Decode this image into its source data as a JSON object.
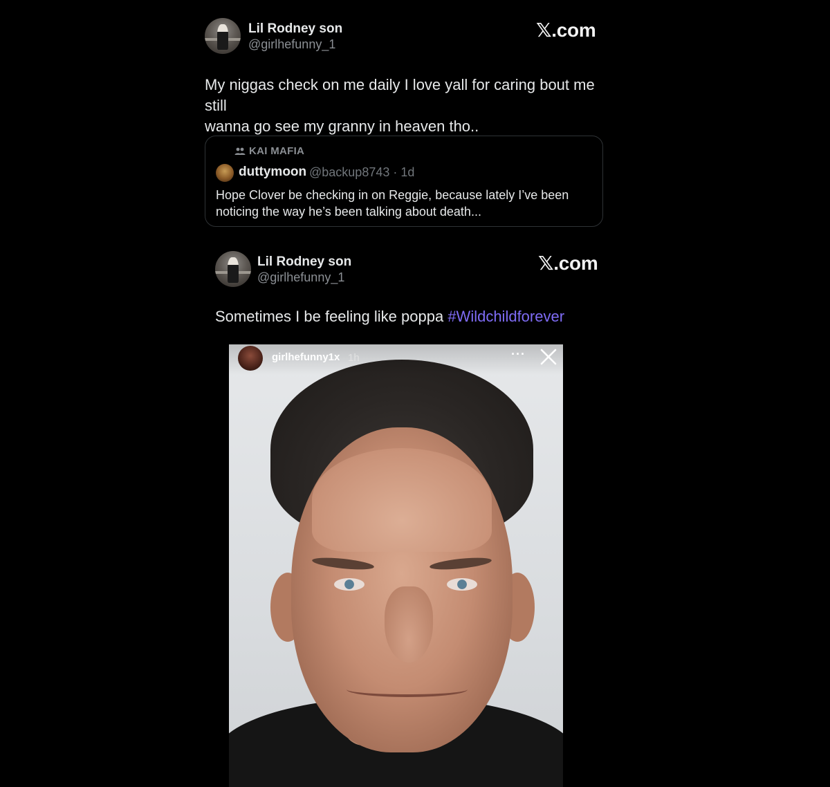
{
  "post1": {
    "author_name": "Lil Rodney son",
    "author_handle": "@girlhefunny_1",
    "brand": "𝕏.com",
    "text_line1": "My niggas check on me daily I love yall for caring bout me still",
    "text_line2": "wanna go see my granny in heaven tho.."
  },
  "quote": {
    "community": "KAI MAFIA",
    "author_name": "duttymoon",
    "meta": "@backup8743 · 1d",
    "text_line1": "Hope Clover  be checking in on Reggie, because lately I’ve been",
    "text_line2": "noticing the way he’s been talking about death..."
  },
  "post2": {
    "author_name": "Lil Rodney son",
    "author_handle": "@girlhefunny_1",
    "brand": "𝕏.com",
    "text": "Sometimes I be feeling like poppa ",
    "hashtag": "#Wildchildforever"
  },
  "story": {
    "username": "girlhefunny1x",
    "time": "1h",
    "more": "···"
  },
  "colors": {
    "background": "#000000",
    "hashtag": "#7f6cf5",
    "secondary_text": "#8b8f94",
    "card_border": "#2f3336"
  },
  "icons": {
    "community": "people-icon",
    "close": "close-icon",
    "more": "more-horizontal-icon"
  }
}
